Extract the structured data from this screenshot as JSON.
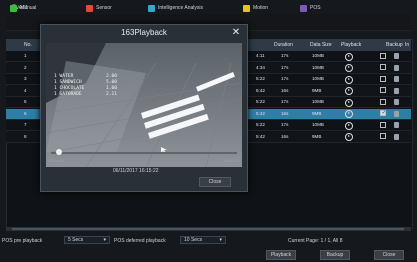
{
  "header": {
    "title": "Event"
  },
  "filters": [
    {
      "label": "Manual",
      "color": "#3bbf3b"
    },
    {
      "label": "Sensor",
      "color": "#e14a3b"
    },
    {
      "label": "Intelligence Analysis",
      "color": "#3aa6c8"
    },
    {
      "label": "Motion",
      "color": "#e6c12e"
    },
    {
      "label": "POS",
      "color": "#7b59b6"
    }
  ],
  "table": {
    "columns": [
      "No.",
      "Duration",
      "Data Size",
      "Playback",
      "Backup",
      "In"
    ],
    "rows": [
      {
        "no": "1",
        "time": "4:11",
        "duration": "17s",
        "size": "10MB",
        "selected": false
      },
      {
        "no": "2",
        "time": "4:34",
        "duration": "17s",
        "size": "10MB",
        "selected": false
      },
      {
        "no": "3",
        "time": "5:22",
        "duration": "17s",
        "size": "10MB",
        "selected": false
      },
      {
        "no": "4",
        "time": "5:42",
        "duration": "16s",
        "size": "9MB",
        "selected": false
      },
      {
        "no": "5",
        "time": "5:22",
        "duration": "17s",
        "size": "10MB",
        "selected": false
      },
      {
        "no": "6",
        "time": "5:42",
        "duration": "16s",
        "size": "9MB",
        "selected": true
      },
      {
        "no": "7",
        "time": "5:22",
        "duration": "17s",
        "size": "10MB",
        "selected": false
      },
      {
        "no": "8",
        "time": "5:42",
        "duration": "16s",
        "size": "9MB",
        "selected": false
      }
    ]
  },
  "footer": {
    "pre_label": "POS pre playback",
    "pre_value": "5 Secs",
    "post_label": "POS deferred playback",
    "post_value": "10 Secs",
    "page": "Current Page: 1 / 1, All 8",
    "buttons": [
      "Playback",
      "Backup",
      "Close"
    ]
  },
  "popup": {
    "title": "163Playback",
    "close_icon": "close-icon",
    "overlay_lines": [
      "1 WATER",
      "1 SANDWICH",
      "1 CHOCOLATE",
      "1 GATORADE"
    ],
    "overlay_prices": [
      "2.00",
      "5.00",
      "1.00",
      "2.11"
    ],
    "time_left": "00:00:01",
    "time_right": "00:00:17",
    "timestamp": "06/11/2017 16:15:22",
    "close_label": "Close"
  }
}
